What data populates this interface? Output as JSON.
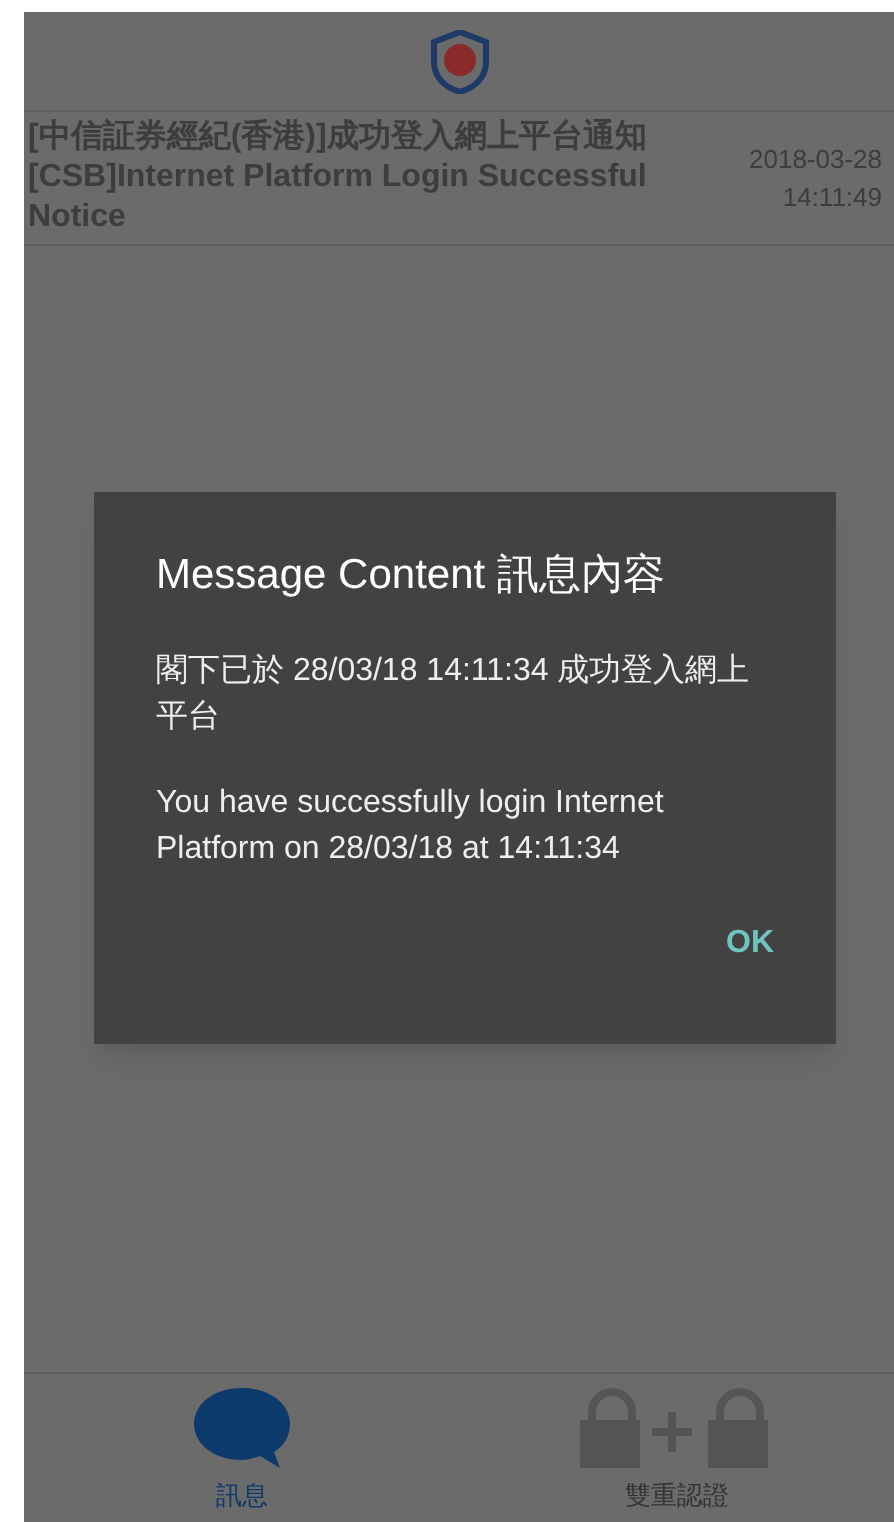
{
  "message_list": [
    {
      "subject": "[中信証券經紀(香港)]成功登入網上平台通知 [CSB]Internet Platform Login Successful Notice",
      "date": "2018-03-28",
      "time": "14:11:49"
    }
  ],
  "dialog": {
    "title": "Message Content 訊息內容",
    "body": [
      "閣下已於 28/03/18 14:11:34 成功登入網上平台",
      "You have successfully login Internet Platform on 28/03/18 at 14:11:34"
    ],
    "button": "OK"
  },
  "tabs": [
    {
      "label": "訊息",
      "kind": "messages",
      "selected": true
    },
    {
      "label": "雙重認證",
      "kind": "two-factor",
      "selected": false
    }
  ]
}
